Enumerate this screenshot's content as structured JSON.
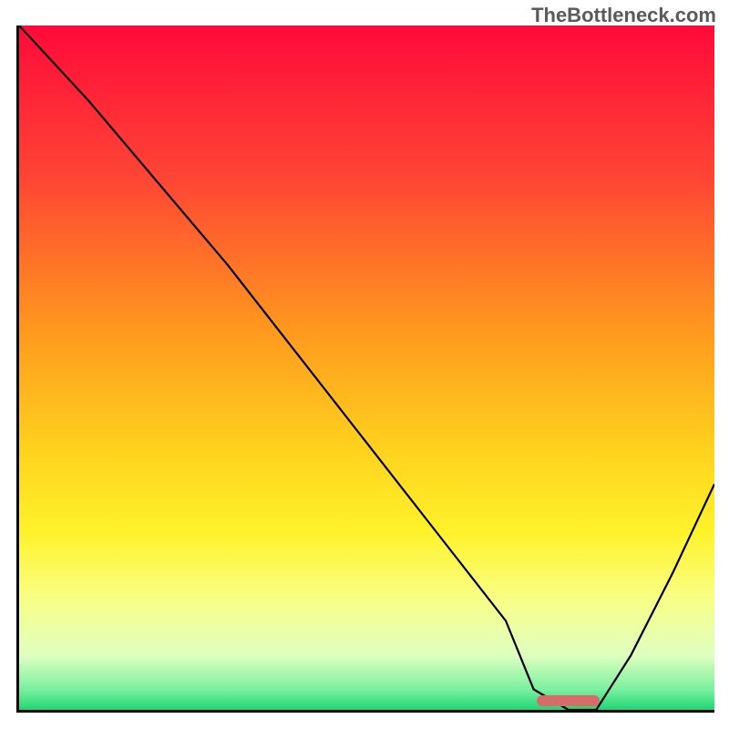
{
  "watermark": "TheBottleneck.com",
  "marker": {
    "color": "#d86a6a",
    "x_pct_center": 79,
    "width_pct": 9
  },
  "chart_data": {
    "type": "line",
    "title": "",
    "xlabel": "",
    "ylabel": "",
    "xlim": [
      0,
      100
    ],
    "ylim": [
      0,
      100
    ],
    "grid": false,
    "gradient_stops": [
      {
        "pct": 0,
        "color": "#ff0a3a"
      },
      {
        "pct": 22,
        "color": "#ff4434"
      },
      {
        "pct": 45,
        "color": "#ff9a1e"
      },
      {
        "pct": 62,
        "color": "#ffd21e"
      },
      {
        "pct": 74,
        "color": "#fff22a"
      },
      {
        "pct": 84,
        "color": "#f8ff88"
      },
      {
        "pct": 92,
        "color": "#dfffc0"
      },
      {
        "pct": 97,
        "color": "#7bf0a0"
      },
      {
        "pct": 100,
        "color": "#1fd672"
      }
    ],
    "series": [
      {
        "name": "bottleneck-curve",
        "color": "#000000",
        "x": [
          0,
          10,
          20,
          30,
          40,
          50,
          60,
          70,
          74,
          79,
          83,
          88,
          94,
          100
        ],
        "y": [
          100,
          89,
          77,
          65,
          52,
          39,
          26,
          13,
          3,
          0,
          0,
          8,
          20,
          33
        ]
      }
    ],
    "marker_range": {
      "x_start": 74.5,
      "x_end": 83.5,
      "y": 0.5
    }
  }
}
